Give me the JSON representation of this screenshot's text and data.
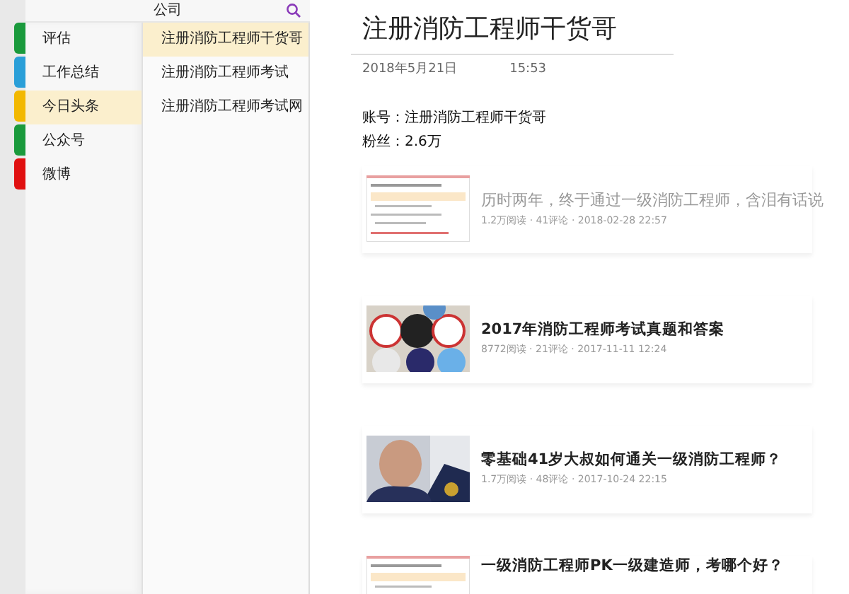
{
  "header": {
    "title": "公司"
  },
  "notebooks": [
    {
      "label": "评估",
      "color": "#1a9a3c",
      "selected": false
    },
    {
      "label": "工作总结",
      "color": "#2a9fd8",
      "selected": false
    },
    {
      "label": "今日头条",
      "color": "#f2b800",
      "selected": true
    },
    {
      "label": "公众号",
      "color": "#1a9a3c",
      "selected": false
    },
    {
      "label": "微博",
      "color": "#e01010",
      "selected": false
    }
  ],
  "notes": [
    {
      "label": "注册消防工程师干货哥",
      "selected": true
    },
    {
      "label": "注册消防工程师考试",
      "selected": false
    },
    {
      "label": "注册消防工程师考试网",
      "selected": false
    }
  ],
  "note": {
    "title": "注册消防工程师干货哥",
    "date": "2018年5月21日",
    "time": "15:53",
    "lines": [
      "账号：注册消防工程师干货哥",
      "粉丝：2.6万"
    ],
    "articles": [
      {
        "kind": "document",
        "title": "历时两年，终于通过一级消防工程师，含泪有话说",
        "meta": "1.2万阅读 · 41评论 · 2018-02-28 22:57",
        "faded": true
      },
      {
        "kind": "picture",
        "title": "2017年消防工程师考试真题和答案",
        "meta": "8772阅读 · 21评论 · 2017-11-11 12:24",
        "faded": false
      },
      {
        "kind": "picture",
        "title": "零基础41岁大叔如何通关一级消防工程师？",
        "meta": "1.7万阅读 · 48评论 · 2017-10-24 22:15",
        "faded": false
      },
      {
        "kind": "document",
        "title": "一级消防工程师PK一级建造师，考哪个好？",
        "faded": false
      }
    ]
  }
}
